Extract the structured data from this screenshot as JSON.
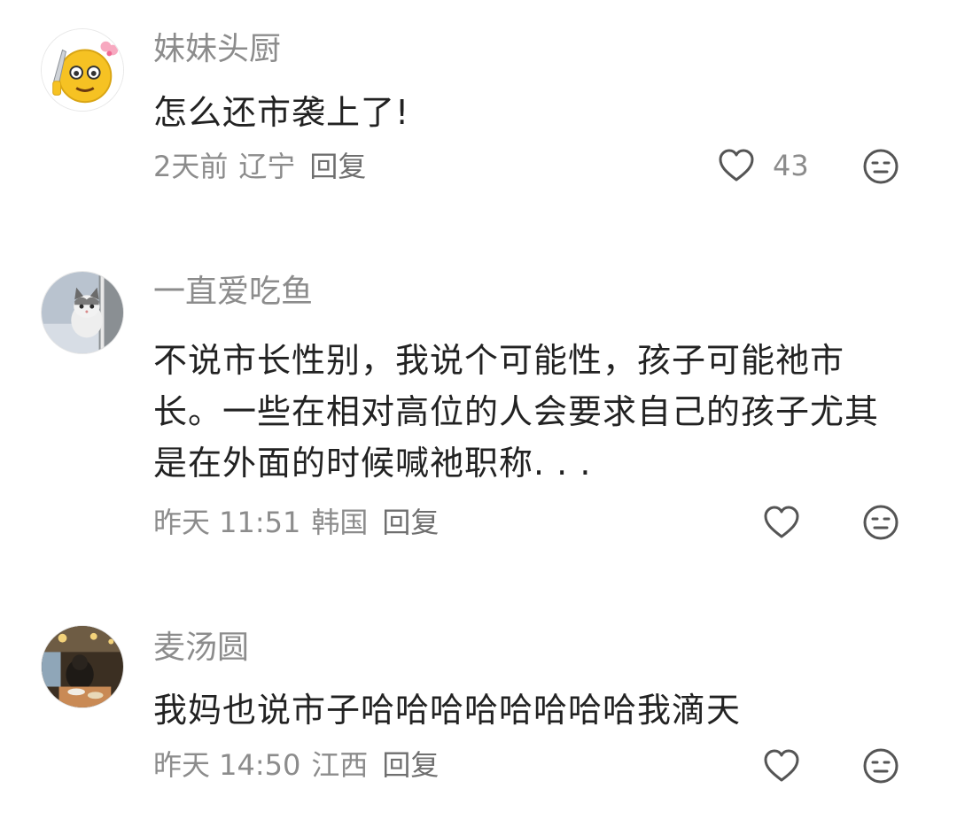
{
  "comments": [
    {
      "username": "妹妹头厨",
      "text": "怎么还市袭上了!",
      "time": "2天前",
      "location": "辽宁",
      "reply_label": "回复",
      "like_count": "43",
      "avatar_icon": "emoji-face-knife-avatar"
    },
    {
      "username": "一直爱吃鱼",
      "text": "不说市长性别，我说个可能性，孩子可能祂市长。一些在相对高位的人会要求自己的孩子尤其是在外面的时候喊祂职称. . .",
      "time": "昨天 11:51",
      "location": "韩国",
      "reply_label": "回复",
      "like_count": "",
      "avatar_icon": "cat-photo-avatar"
    },
    {
      "username": "麦汤圆",
      "text": "我妈也说市子哈哈哈哈哈哈哈哈我滴天",
      "time": "昨天 14:50",
      "location": "江西",
      "reply_label": "回复",
      "like_count": "",
      "avatar_icon": "restaurant-photo-avatar"
    }
  ],
  "icons": {
    "like": "heart-outline-icon",
    "dislike": "neutral-face-icon"
  },
  "colors": {
    "text": "#222222",
    "secondary": "#8c8c8c",
    "icon": "#555555"
  }
}
